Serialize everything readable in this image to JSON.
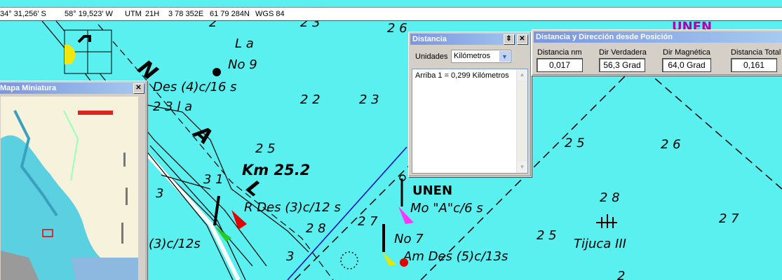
{
  "status": {
    "lat": "34° 31,256' S",
    "lon": "58° 19,523' W",
    "utm_label": "UTM",
    "utm_zone": "21H",
    "easting": "3 78 352E",
    "northing": "61 79 284N",
    "datum": "WGS 84"
  },
  "chart_labels": {
    "la": "L a",
    "no9": "No 9",
    "des4": "Des (4)c/16 s",
    "s231a": "2 3 l a",
    "d22": "2 2",
    "d23": "2 3",
    "d25a": "2 5",
    "d26top": "2 6",
    "d2top": "2",
    "d23top": "2 3",
    "km": "Km  25.2",
    "d31": "3 1",
    "d3left": "3",
    "rdes": "R Des (3)c/12 s",
    "d28": "2 8",
    "d27": "2 7",
    "unen": "UNEN",
    "mo": "Mo \"A\"c/6 s",
    "no7": "No 7",
    "amdes": "Am Des (5)c/13s",
    "d3c12s": "(3)c/12s",
    "d3bottom": "3",
    "d25b": "2 5",
    "d25c": "2 5",
    "d26": "2 6",
    "d28b": "2 8",
    "d27b": "2 7",
    "tijuca": "Tijuca  III",
    "d2bot": "2",
    "unentop": "UNEN",
    "big_n": "N",
    "big_a": "A",
    "big_l": "L"
  },
  "minimap_window": {
    "title": "Mapa Miniatura",
    "close": "✕"
  },
  "distance_window": {
    "title": "Distancia",
    "units_label": "Unidades",
    "units_value": "Kilómetros",
    "output": "Arriba 1 = 0,299 Kilómetros",
    "close": "✕",
    "pin": "⇕"
  },
  "bearing_window": {
    "title": "Distancia y Dirección desde Posición",
    "columns": [
      {
        "label": "Distancia nm",
        "value": "0,017"
      },
      {
        "label": "Dir Verdadera",
        "value": "56,3 Grad"
      },
      {
        "label": "Dir Magnética",
        "value": "64,0 Grad"
      },
      {
        "label": "Distancia Total",
        "value": "0,161"
      }
    ]
  },
  "colors": {
    "water": "#5af0f0",
    "land": "#f7f2dc",
    "titlebar": "#7a96df"
  }
}
